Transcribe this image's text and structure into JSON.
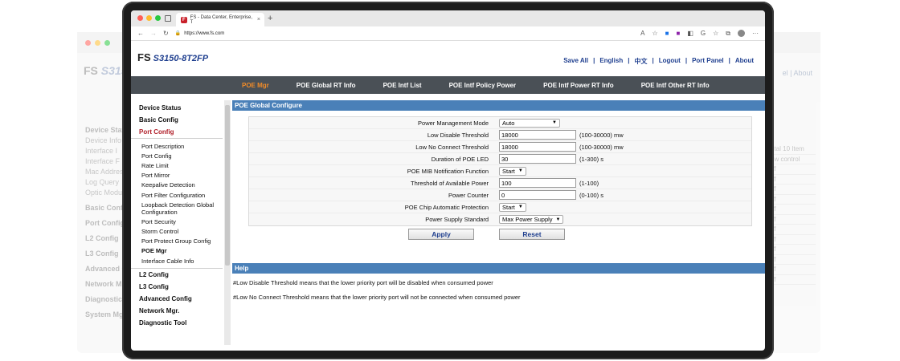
{
  "browser": {
    "tab_title": "FS - Data Center, Enterprise, T",
    "tab_close": "×",
    "new_tab": "+",
    "favicon": "F",
    "url": "https://www.fs.com",
    "traffic_colors": [
      "#ff5f57",
      "#febc2e",
      "#28c840"
    ]
  },
  "header": {
    "brand": "FS",
    "model": "S3150-8T2FP",
    "links": [
      "Save All",
      "English",
      "中文",
      "Logout",
      "Port Panel",
      "About"
    ]
  },
  "nav": {
    "items": [
      "POE Mgr",
      "POE Global RT Info",
      "POE Intf List",
      "POE Intf Policy Power",
      "POE Intf Power RT Info",
      "POE Intf Other RT Info"
    ],
    "active": "POE Mgr"
  },
  "sidebar": {
    "top": [
      "Device Status",
      "Basic Config"
    ],
    "port_config": "Port Config",
    "items": [
      "Port Description",
      "Port Config",
      "Rate Limit",
      "Port Mirror",
      "Keepalive Detection",
      "Port Filter Configuration",
      "Loopback Detection Global Configuration",
      "Port Security",
      "Storm Control",
      "Port Protect Group Config",
      "POE Mgr",
      "Interface Cable Info"
    ],
    "bottom": [
      "L2 Config",
      "L3 Config",
      "Advanced Config",
      "Network Mgr.",
      "Diagnostic Tool"
    ]
  },
  "form": {
    "title": "POE Global Configure",
    "rows": [
      {
        "label": "Power Management Mode",
        "type": "select",
        "value": "Auto"
      },
      {
        "label": "Low Disable Threshold",
        "type": "input",
        "value": "18000",
        "hint": "(100-30000) mw"
      },
      {
        "label": "Low No Connect Threshold",
        "type": "input",
        "value": "18000",
        "hint": "(100-30000) mw"
      },
      {
        "label": "Duration of POE LED",
        "type": "input",
        "value": "30",
        "hint": "(1-300) s"
      },
      {
        "label": "POE MIB Notification Function",
        "type": "select",
        "value": "Start"
      },
      {
        "label": "Threshold of Available Power",
        "type": "input",
        "value": "100",
        "hint": "(1-100)"
      },
      {
        "label": "Power Counter",
        "type": "input",
        "value": "0",
        "hint": "(0-100) s"
      },
      {
        "label": "POE Chip Automatic Protection",
        "type": "select",
        "value": "Start"
      },
      {
        "label": "Power Supply Standard",
        "type": "select",
        "value": "Max Power Supply"
      }
    ],
    "apply": "Apply",
    "reset": "Reset"
  },
  "help": {
    "title": "Help",
    "lines": [
      "#Low Disable Threshold means that the lower priority port will be disabled when consumed power",
      "#Low No Connect Threshold means that the lower priority port will not be connected when consumed power"
    ]
  },
  "ghost": {
    "brand": "FS",
    "model": "S315",
    "links": "el  |  About",
    "about": "About",
    "sidebar": [
      "Device Status",
      "Basic Config",
      "Port Config",
      "Basic Config",
      "Port Config",
      "L2 Config",
      "L3 Config",
      "Advanced C",
      "Network M",
      "Diagnostic",
      "System Mg"
    ],
    "sidebar_sub": [
      "Device Info",
      "Interface I",
      "Interface F",
      "Mac Addres",
      "Log Query",
      "Optic Modu"
    ],
    "right": [
      "Total 10 Item",
      "flow control",
      "Off",
      "Off",
      "Off",
      "Off",
      "Off",
      "Off",
      "Off",
      "Off",
      "Off",
      "Off",
      "Off",
      "Off",
      "Off",
      "Off"
    ]
  }
}
